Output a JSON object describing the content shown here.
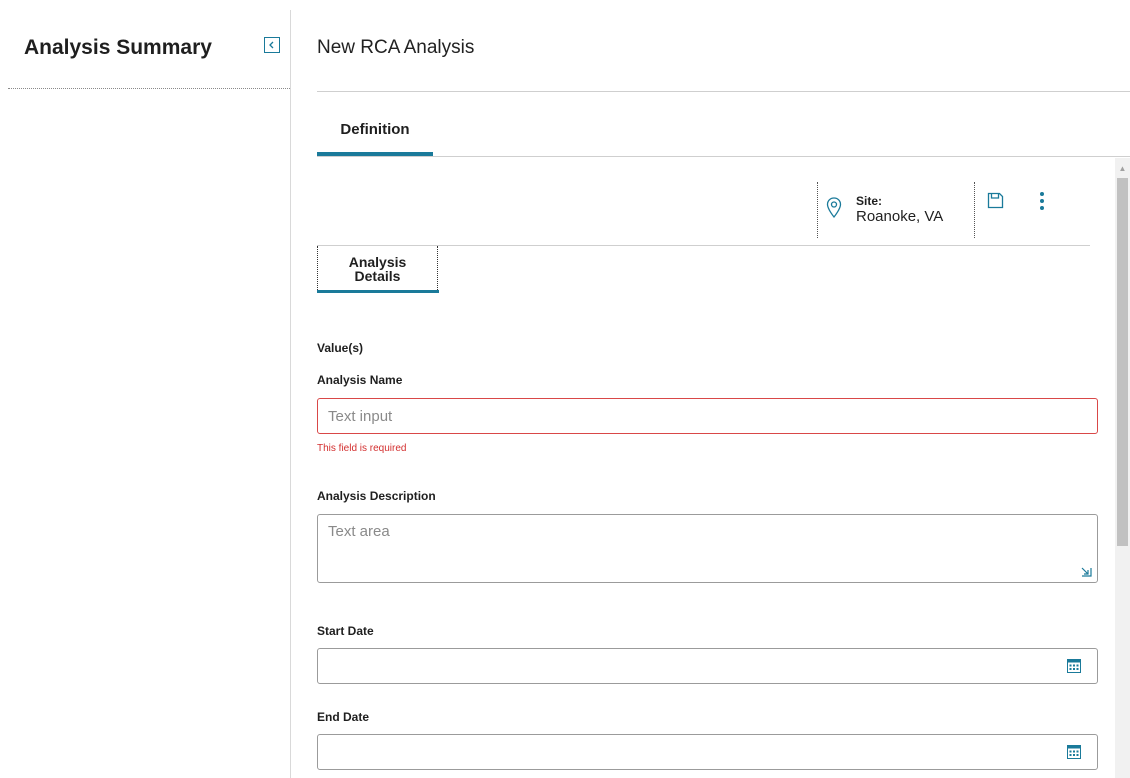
{
  "sidebar": {
    "title": "Analysis Summary"
  },
  "header": {
    "title": "New RCA Analysis"
  },
  "tabs": [
    {
      "label": "Definition",
      "active": true
    }
  ],
  "toolbar": {
    "site_label": "Site:",
    "site_value": "Roanoke, VA"
  },
  "subtabs": [
    {
      "label": "Analysis Details",
      "active": true
    }
  ],
  "form": {
    "section_label": "Value(s)",
    "analysis_name": {
      "label": "Analysis Name",
      "placeholder": "Text input",
      "value": "",
      "error": "This field is required"
    },
    "analysis_description": {
      "label": "Analysis Description",
      "placeholder": "Text area",
      "value": ""
    },
    "start_date": {
      "label": "Start Date",
      "value": ""
    },
    "end_date": {
      "label": "End Date",
      "value": ""
    }
  },
  "colors": {
    "accent": "#1a7a9a",
    "error": "#d94848"
  }
}
